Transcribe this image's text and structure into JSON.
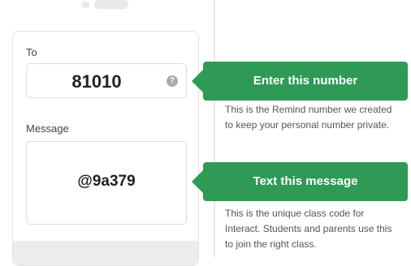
{
  "form": {
    "to_label": "To",
    "to_value": "81010",
    "help_icon": "question-icon",
    "message_label": "Message",
    "message_value": "@9a379"
  },
  "callouts": [
    {
      "title": "Enter this number",
      "description": "This is the Remind number we created to keep your personal number private."
    },
    {
      "title": "Text this message",
      "description": "This is the unique class code for Interact. Students and parents use this to join the right class."
    }
  ],
  "colors": {
    "callout_green": "#2e9a56",
    "border_gray": "#dcdcdc"
  }
}
